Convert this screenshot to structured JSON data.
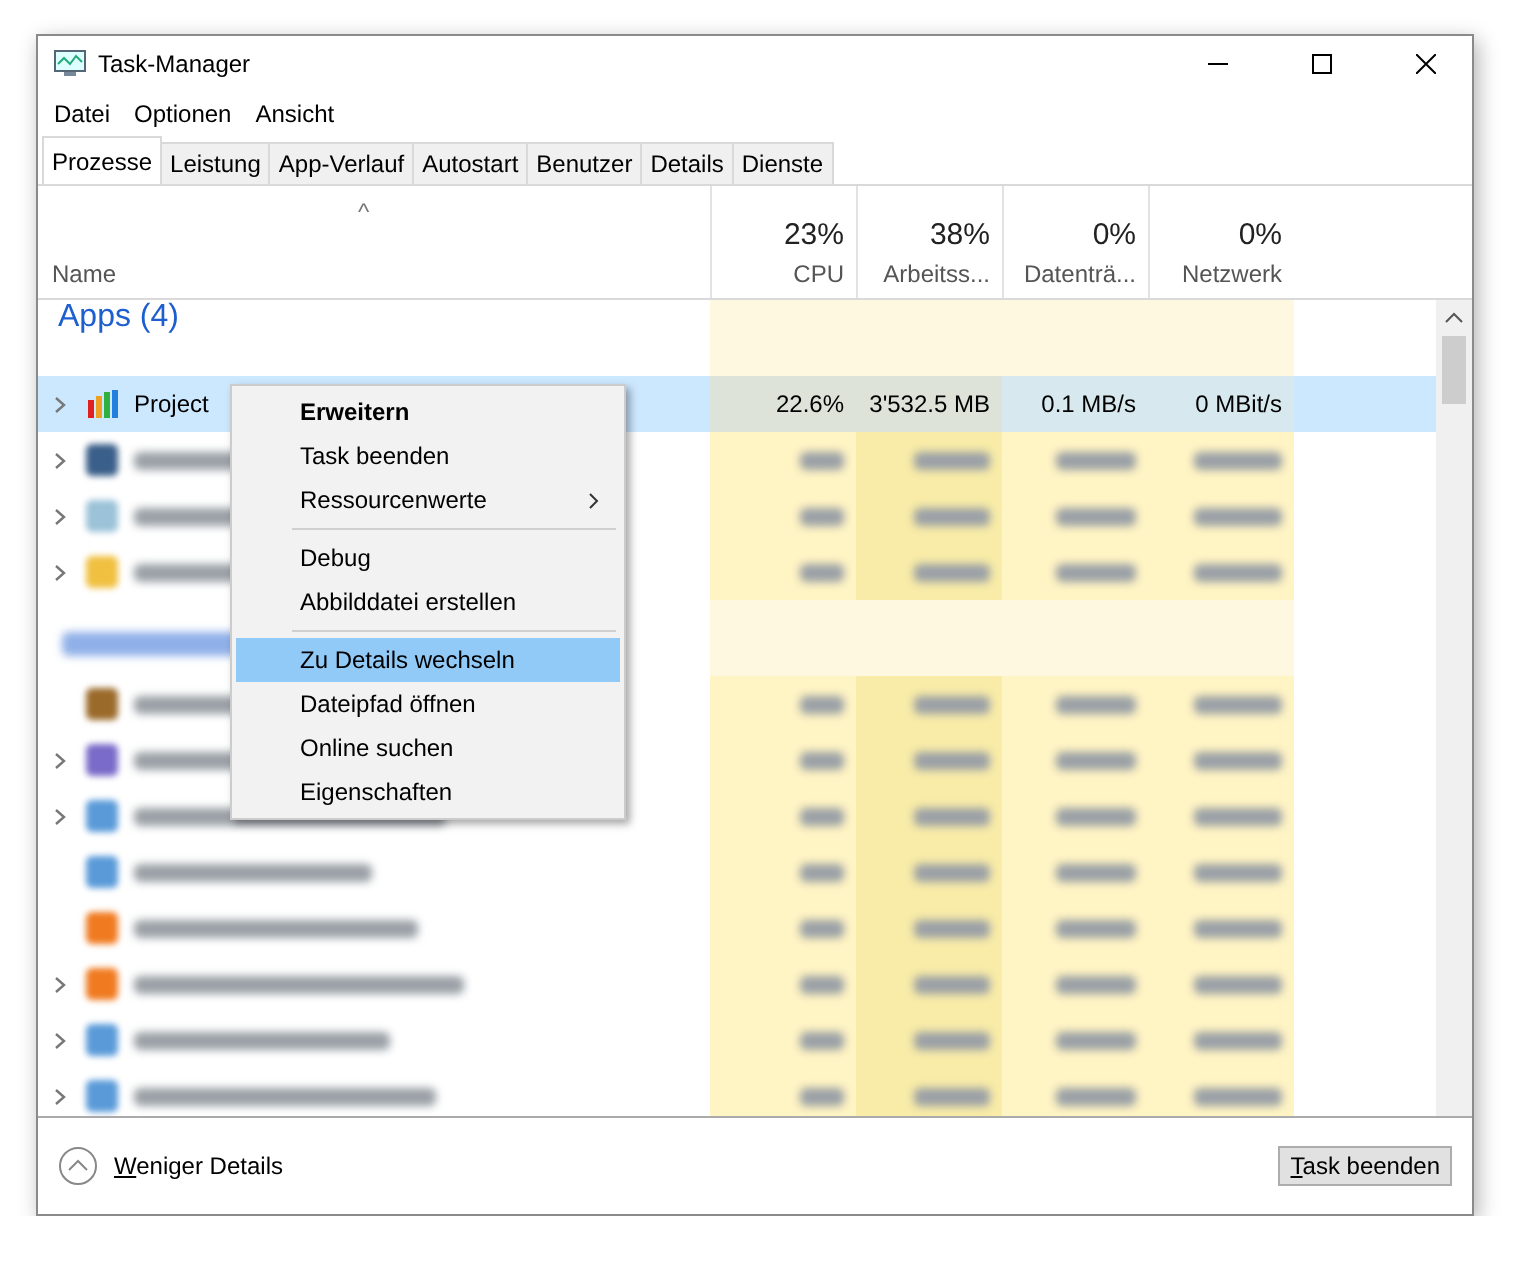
{
  "window": {
    "title": "Task-Manager"
  },
  "menu": [
    "Datei",
    "Optionen",
    "Ansicht"
  ],
  "tabs": [
    {
      "label": "Prozesse",
      "selected": true
    },
    {
      "label": "Leistung",
      "selected": false
    },
    {
      "label": "App-Verlauf",
      "selected": false
    },
    {
      "label": "Autostart",
      "selected": false
    },
    {
      "label": "Benutzer",
      "selected": false
    },
    {
      "label": "Details",
      "selected": false
    },
    {
      "label": "Dienste",
      "selected": false
    }
  ],
  "sort_indicator": "^",
  "columns": [
    {
      "label": "Name"
    },
    {
      "total": "23%",
      "label": "CPU"
    },
    {
      "total": "38%",
      "label": "Arbeitss..."
    },
    {
      "total": "0%",
      "label": "Datenträ..."
    },
    {
      "total": "0%",
      "label": "Netzwerk"
    }
  ],
  "groups": [
    {
      "title": "Apps (4)",
      "redacted": false,
      "rows": [
        {
          "name": "Project",
          "kind": "bars",
          "expandable": true,
          "selected": true,
          "redacted": false,
          "cells": [
            "22.6%",
            "3'532.5 MB",
            "0.1 MB/s",
            "0 MBit/s"
          ]
        },
        {
          "kind": "steam",
          "expandable": true,
          "selected": false,
          "redacted": true
        },
        {
          "kind": "monitor",
          "expandable": true,
          "selected": false,
          "redacted": true
        },
        {
          "kind": "folder",
          "expandable": true,
          "selected": false,
          "redacted": true
        }
      ]
    },
    {
      "redacted": true,
      "rows": [
        {
          "kind": "acro",
          "expandable": false,
          "selected": false,
          "redacted": true
        },
        {
          "kind": "adobe",
          "expandable": true,
          "selected": false,
          "redacted": true
        },
        {
          "kind": "service",
          "expandable": true,
          "selected": false,
          "redacted": true
        },
        {
          "kind": "service",
          "expandable": false,
          "selected": false,
          "redacted": true
        },
        {
          "kind": "avast",
          "expandable": false,
          "selected": false,
          "redacted": true
        },
        {
          "kind": "avast",
          "expandable": true,
          "selected": false,
          "redacted": true
        },
        {
          "kind": "service",
          "expandable": true,
          "selected": false,
          "redacted": true
        },
        {
          "kind": "service",
          "expandable": true,
          "selected": false,
          "redacted": true
        }
      ]
    }
  ],
  "context_menu": [
    {
      "kind": "item",
      "label": "Erweitern",
      "bold": true,
      "selected": false
    },
    {
      "kind": "item",
      "label": "Task beenden",
      "bold": false,
      "selected": false
    },
    {
      "kind": "submenu",
      "label": "Ressourcenwerte",
      "bold": false,
      "selected": false
    },
    {
      "kind": "separator"
    },
    {
      "kind": "item",
      "label": "Debug",
      "bold": false,
      "selected": false
    },
    {
      "kind": "item",
      "label": "Abbilddatei erstellen",
      "bold": false,
      "selected": false
    },
    {
      "kind": "separator"
    },
    {
      "kind": "item",
      "label": "Zu Details wechseln",
      "bold": false,
      "selected": true
    },
    {
      "kind": "item",
      "label": "Dateipfad öffnen",
      "bold": false,
      "selected": false
    },
    {
      "kind": "item",
      "label": "Online suchen",
      "bold": false,
      "selected": false
    },
    {
      "kind": "item",
      "label": "Eigenschaften",
      "bold": false,
      "selected": false
    }
  ],
  "footer": {
    "toggle": "Weniger Details",
    "button": "Task beenden"
  }
}
